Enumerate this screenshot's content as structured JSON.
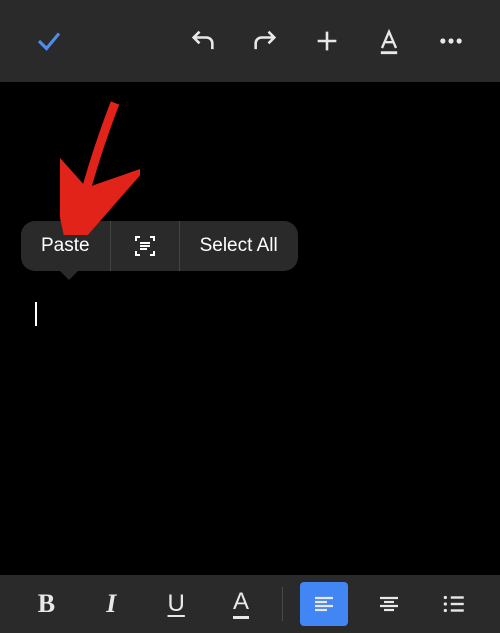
{
  "context_menu": {
    "paste": "Paste",
    "select_all": "Select All"
  },
  "bottom": {
    "bold": "B",
    "italic": "I",
    "underline": "U",
    "textcolor": "A"
  }
}
